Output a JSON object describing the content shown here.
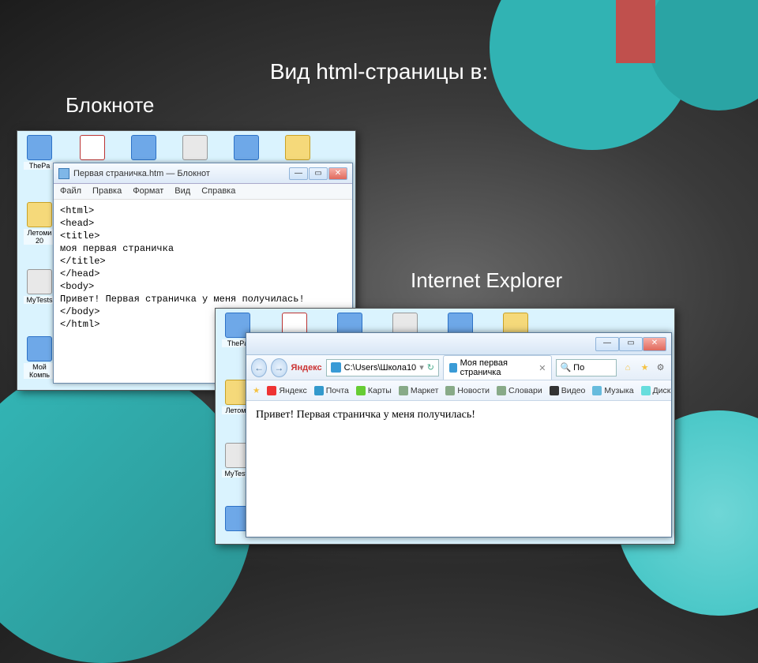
{
  "slide": {
    "title": "Вид html-страницы в:",
    "label_notepad": "Блокноте",
    "label_ie": "Internet Explorer"
  },
  "desktop": {
    "row1": [
      {
        "label": "ThePa"
      },
      {
        "label": ""
      },
      {
        "label": ""
      },
      {
        "label": ""
      },
      {
        "label": ""
      },
      {
        "label": ""
      },
      {
        "label": ""
      }
    ],
    "row1_ie": [
      {
        "label": "ThePa"
      },
      {
        "label": ""
      },
      {
        "label": ""
      },
      {
        "label": ""
      },
      {
        "label": ""
      },
      {
        "label": ""
      },
      {
        "label": ""
      }
    ],
    "col_np": [
      {
        "label": "Летоми\n20"
      },
      {
        "label": "MyTests"
      },
      {
        "label": "Мой\nКомпь"
      }
    ],
    "col_ie": [
      {
        "label": "Летоми"
      },
      {
        "label": "MyTests"
      },
      {
        "label": ""
      }
    ]
  },
  "notepad": {
    "title": "Первая страничка.htm — Блокнот",
    "menu": [
      "Файл",
      "Правка",
      "Формат",
      "Вид",
      "Справка"
    ],
    "content": "<html>\n<head>\n<title>\nмоя первая страничка\n</title>\n</head>\n<body>\nПривет! Первая страничка у меня получилась!\n</body>\n</html>"
  },
  "ie": {
    "address_prefix": "Яндекс",
    "address": "C:\\Users\\Школа10",
    "search_placeholder": "По",
    "tab_title": "Моя первая страничка",
    "favorites": [
      {
        "label": "Яндекс",
        "color": "#e33"
      },
      {
        "label": "Почта",
        "color": "#39c"
      },
      {
        "label": "Карты",
        "color": "#6c3"
      },
      {
        "label": "Маркет",
        "color": "#8a8"
      },
      {
        "label": "Новости",
        "color": "#8a8"
      },
      {
        "label": "Словари",
        "color": "#8a8"
      },
      {
        "label": "Видео",
        "color": "#333"
      },
      {
        "label": "Музыка",
        "color": "#6bd"
      },
      {
        "label": "Диск",
        "color": "#6dd"
      }
    ],
    "page_text": "Привет! Первая страничка у меня получилась!"
  }
}
